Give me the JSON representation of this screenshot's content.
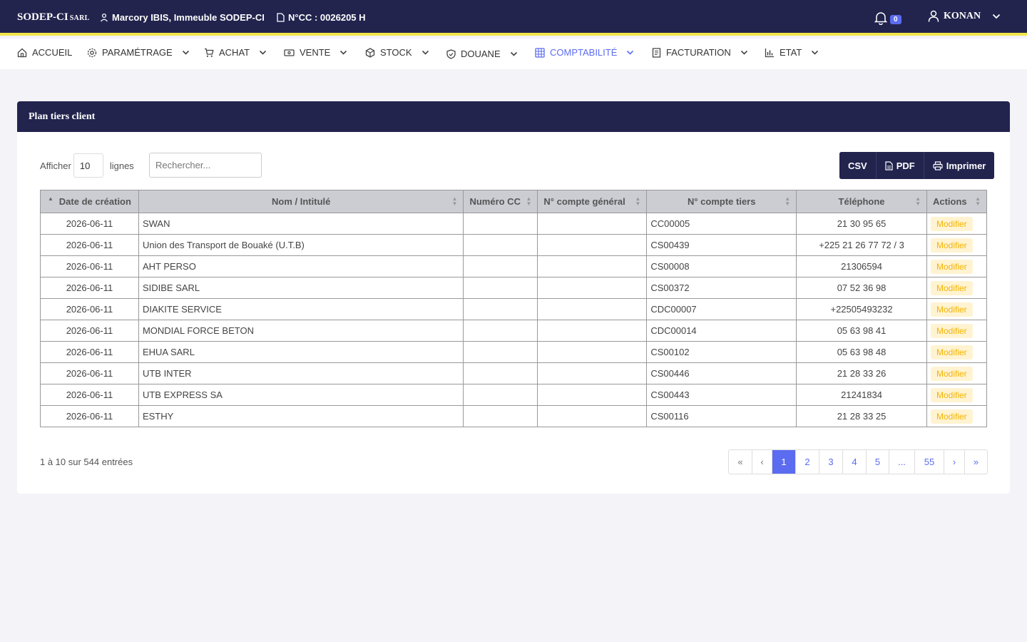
{
  "topbar": {
    "brand": "SODEP-CI",
    "brand_suffix": "SARL",
    "location": "Marcory IBIS, Immeuble SODEP-CI",
    "ncc": "N°CC : 0026205 H",
    "notifications": "0",
    "user": "KONAN"
  },
  "nav": {
    "accueil": "ACCUEIL",
    "parametrage": "PARAMÉTRAGE",
    "achat": "ACHAT",
    "vente": "VENTE",
    "stock": "STOCK",
    "douane": "DOUANE",
    "comptabilite": "COMPTABILITÉ",
    "facturation": "FACTURATION",
    "etat": "ETAT"
  },
  "card": {
    "title": "Plan tiers client",
    "show_label": "Afficher",
    "page_length": "10",
    "lines_label": "lignes",
    "search_placeholder": "Rechercher...",
    "btn_csv": "CSV",
    "btn_pdf": "PDF",
    "btn_print": "Imprimer"
  },
  "table": {
    "headers": {
      "date": "Date de création",
      "name": "Nom / Intitulé",
      "cc": "Numéro CC",
      "general": "N° compte général",
      "tiers": "N° compte tiers",
      "phone": "Téléphone",
      "actions": "Actions"
    },
    "action_label": "Modifier",
    "rows": [
      {
        "date": "2026-06-11",
        "name": "SWAN",
        "cc": "",
        "general": "",
        "tiers": "CC00005",
        "phone": "21 30 95 65"
      },
      {
        "date": "2026-06-11",
        "name": "Union des Transport de Bouaké (U.T.B)",
        "cc": "",
        "general": "",
        "tiers": "CS00439",
        "phone": "+225 21 26 77 72 / 3"
      },
      {
        "date": "2026-06-11",
        "name": "AHT PERSO",
        "cc": "",
        "general": "",
        "tiers": "CS00008",
        "phone": "21306594"
      },
      {
        "date": "2026-06-11",
        "name": "SIDIBE SARL",
        "cc": "",
        "general": "",
        "tiers": "CS00372",
        "phone": "07 52 36 98"
      },
      {
        "date": "2026-06-11",
        "name": "DIAKITE SERVICE",
        "cc": "",
        "general": "",
        "tiers": "CDC00007",
        "phone": "+22505493232"
      },
      {
        "date": "2026-06-11",
        "name": "MONDIAL FORCE BETON",
        "cc": "",
        "general": "",
        "tiers": "CDC00014",
        "phone": "05 63 98 41"
      },
      {
        "date": "2026-06-11",
        "name": "EHUA SARL",
        "cc": "",
        "general": "",
        "tiers": "CS00102",
        "phone": "05 63 98 48"
      },
      {
        "date": "2026-06-11",
        "name": "UTB INTER",
        "cc": "",
        "general": "",
        "tiers": "CS00446",
        "phone": "21 28 33 26"
      },
      {
        "date": "2026-06-11",
        "name": "UTB EXPRESS SA",
        "cc": "",
        "general": "",
        "tiers": "CS00443",
        "phone": "21241834"
      },
      {
        "date": "2026-06-11",
        "name": "ESTHY",
        "cc": "",
        "general": "",
        "tiers": "CS00116",
        "phone": "21 28 33 25"
      }
    ]
  },
  "footer": {
    "info": "1 à 10 sur 544 entrées",
    "pager": {
      "first": "«",
      "prev": "‹",
      "pages": [
        "1",
        "2",
        "3",
        "4",
        "5"
      ],
      "ellipsis": "...",
      "last_page": "55",
      "next": "›",
      "last": "»"
    }
  },
  "colors": {
    "navy": "#22244e",
    "accent": "#5b6cf0",
    "yellow_stripe": "#f3e54a",
    "modifier_bg": "#fff3d1",
    "modifier_text": "#f5b400"
  }
}
